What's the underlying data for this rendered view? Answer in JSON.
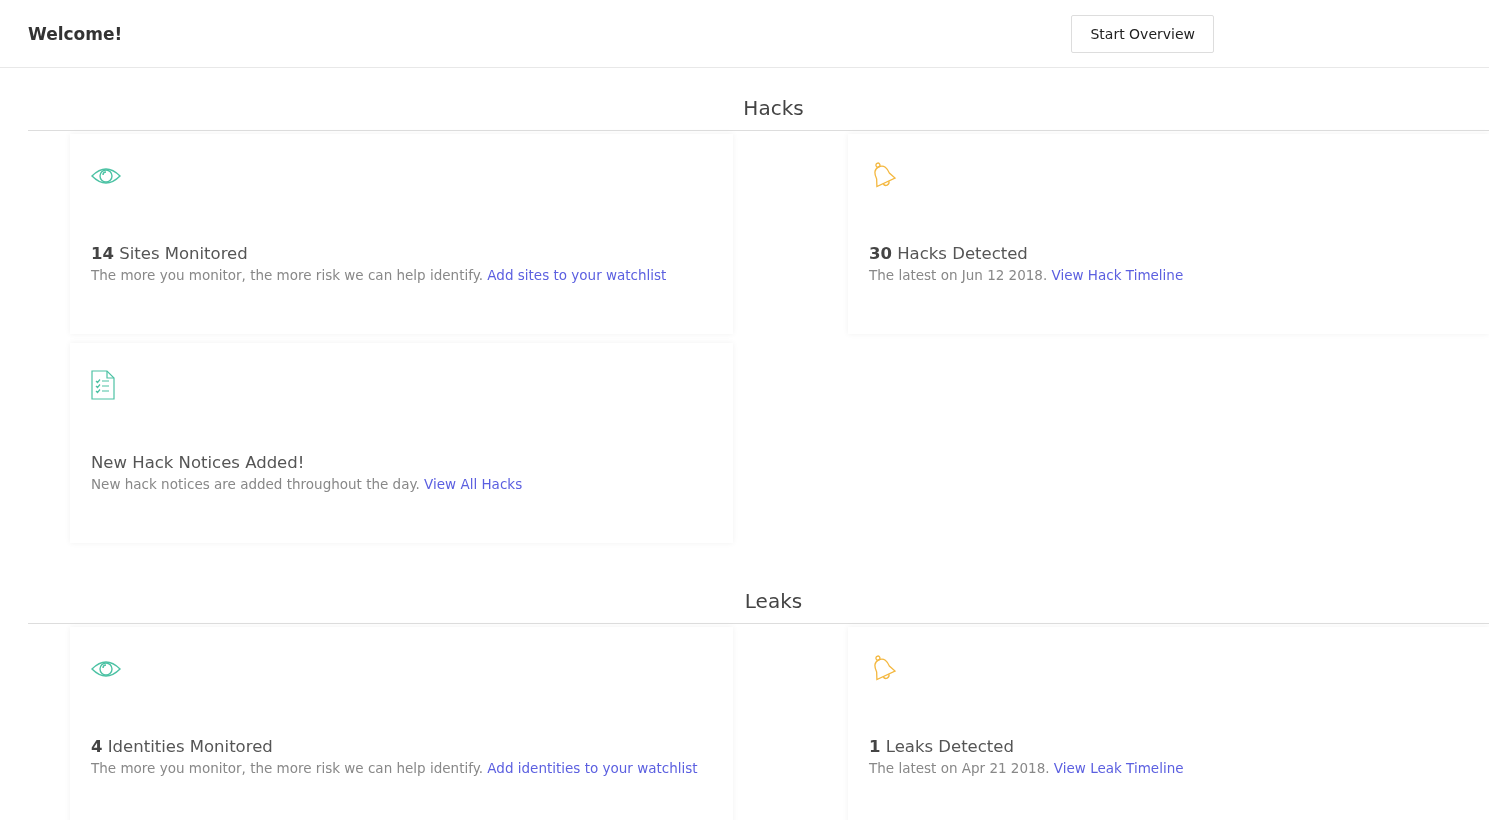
{
  "header": {
    "title": "Welcome!",
    "button": "Start Overview"
  },
  "sections": [
    {
      "title": "Hacks",
      "cards": [
        {
          "kind": "eye",
          "title": "**14** Sites Monitored",
          "text": "The more you monitor, the more risk we can help identify.",
          "link": "Add sites to your watchlist"
        },
        {
          "kind": "bell",
          "title": "**30** Hacks Detected",
          "text": "The latest on Jun 12 2018.",
          "link": "View Hack Timeline"
        },
        {
          "kind": "checklist",
          "title": "New Hack Notices Added!",
          "text": "New hack notices are added throughout the day.",
          "link": "View All Hacks"
        }
      ]
    },
    {
      "title": "Leaks",
      "cards": [
        {
          "kind": "eye",
          "title": "**4** Identities Monitored",
          "text": "The more you monitor, the more risk we can help identify.",
          "link": "Add identities to your watchlist"
        },
        {
          "kind": "bell",
          "title": "**1** Leaks Detected",
          "text": "The latest on Apr 21 2018.",
          "link": "View Leak Timeline"
        }
      ]
    }
  ]
}
